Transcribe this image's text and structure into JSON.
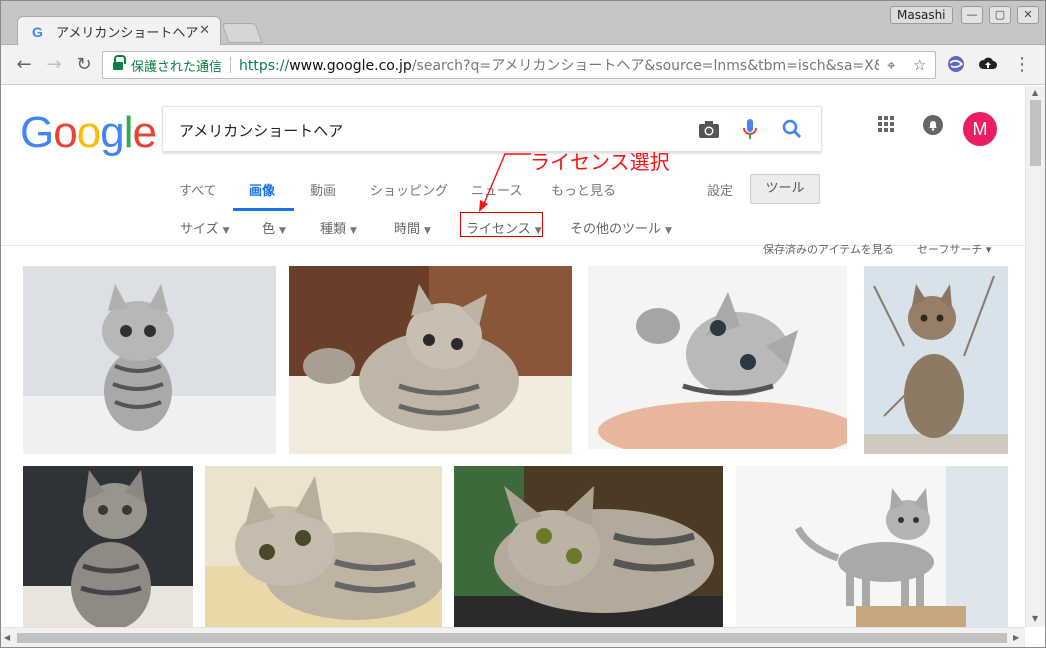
{
  "window": {
    "tab_title": "アメリカンショートヘア",
    "tab_close": "✕",
    "user_badge": "Masashi",
    "minimize": "—",
    "maximize": "▢",
    "close": "✕"
  },
  "toolbar": {
    "secure_label": "保護された通信",
    "url_scheme": "https://",
    "url_host": "www.google.co.jp",
    "url_path": "/search?q=アメリカンショートヘア&source=lnms&tbm=isch&sa=X&ved=…"
  },
  "search": {
    "logo": "Google",
    "query": "アメリカンショートヘア"
  },
  "header": {
    "avatar_letter": "M"
  },
  "tabs": [
    {
      "label": "すべて"
    },
    {
      "label": "画像"
    },
    {
      "label": "動画"
    },
    {
      "label": "ショッピング"
    },
    {
      "label": "ニュース"
    },
    {
      "label": "もっと見る"
    },
    {
      "label": "設定"
    }
  ],
  "tools_label": "ツール",
  "filters": [
    {
      "label": "サイズ"
    },
    {
      "label": "色"
    },
    {
      "label": "種類"
    },
    {
      "label": "時間"
    },
    {
      "label": "ライセンス"
    },
    {
      "label": "その他のツール"
    }
  ],
  "annotation": "ライセンス選択",
  "saved_items": "保存済みのアイテムを見る",
  "safe_search": "セーフサーチ ▾",
  "colors": {
    "accent": "#1a73e8",
    "annotation": "#ff1010",
    "secure": "#0b8043",
    "avatar": "#e91e63"
  }
}
